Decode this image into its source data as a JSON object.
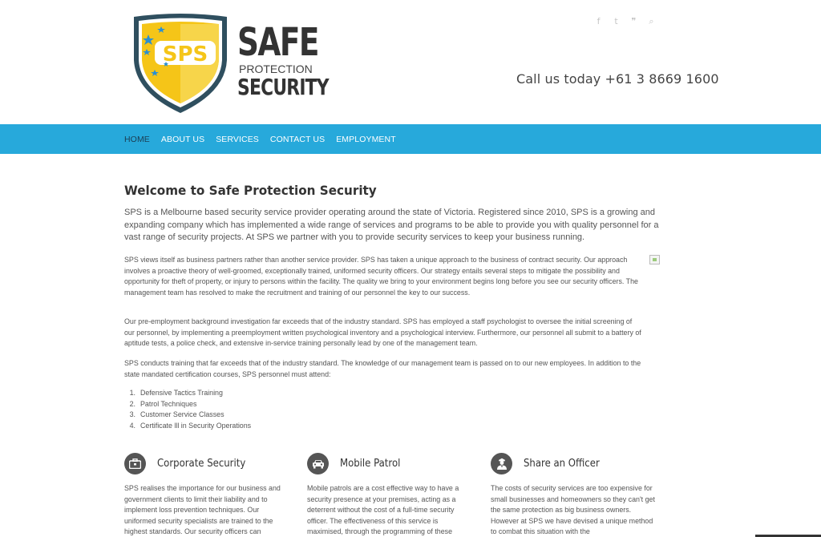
{
  "header": {
    "logo": {
      "badge": "SPS",
      "line1": "SAFE",
      "line2": "PROTECTION",
      "line3": "SECURITY"
    },
    "social_icons": [
      "facebook-icon",
      "twitter-icon",
      "rss-icon",
      "search-icon"
    ],
    "social_glyphs": [
      "f",
      "t",
      "❞",
      "⌕"
    ],
    "phone_text": "Call us today +61 3 8669 1600"
  },
  "nav": {
    "items": [
      "HOME",
      "ABOUT US",
      "SERVICES",
      "CONTACT US",
      "EMPLOYMENT"
    ]
  },
  "main": {
    "title": "Welcome to Safe Protection Security",
    "lead": "SPS is a Melbourne based security service provider operating around the state of Victoria. Registered since 2010, SPS is a growing and expanding company which has implemented a wide range of services and programs to be able to provide you with quality personnel for a vast range of security projects. At SPS we partner with you to provide security services to keep your business running.",
    "paragraphs": [
      "SPS views itself as business partners rather than another service provider. SPS has taken a unique approach to the business of contract security. Our approach involves a proactive theory of well-groomed, exceptionally trained, uniformed security officers. Our strategy entails several steps to mitigate the possibility and opportunity for theft of property, or injury to persons within the facility. The quality we bring to your environment begins long before you see our security officers. The management team has resolved to make the recruitment and training of our personnel the key to our success.",
      "Our pre-employment background investigation far exceeds that of the industry standard. SPS has employed a staff psychologist to oversee the initial screening of our personnel, by implementing a preemployment written psychological inventory and a psychological interview. Furthermore, our personnel all submit to a battery of aptitude tests, a police check, and extensive in-service training personally lead by one of the management team.",
      "SPS conducts training that far exceeds that of the industry standard. The knowledge of our management team is passed on to our new employees. In addition to the state mandated certification courses, SPS personnel must attend:"
    ],
    "list": [
      {
        "num": "1.",
        "text": "Defensive Tactics Training"
      },
      {
        "num": "2.",
        "text": "Patrol Techniques"
      },
      {
        "num": "3.",
        "text": "Customer Service Classes"
      },
      {
        "num": "4.",
        "text": "Certificate lll in Security Operations"
      }
    ]
  },
  "features": [
    {
      "title": "Corporate Security",
      "icon": "briefcase-icon",
      "text": "SPS realises the importance for our business and government clients to limit their liability and to implement loss prevention techniques.  Our uniformed security specialists are trained to the highest standards. Our security officers can"
    },
    {
      "title": "Mobile Patrol",
      "icon": "car-icon",
      "text": "Mobile patrols are a cost effective way to have a security presence at your premises, acting as a deterrent without the cost of a full-time security officer. The effectiveness of this service is maximised, through the programming of these"
    },
    {
      "title": "Share an Officer",
      "icon": "officer-icon",
      "text": "The costs of security services are too expensive for small businesses and homeowners so they can't get the same protection as big business owners. However at SPS we have devised a unique method to combat this situation with the"
    }
  ],
  "colors": {
    "nav_bg": "#27a9db",
    "nav_active": "#1c3d52",
    "shield_yellow": "#f5c518",
    "shield_border": "#2f4f5f",
    "icon_circle": "#555555"
  }
}
